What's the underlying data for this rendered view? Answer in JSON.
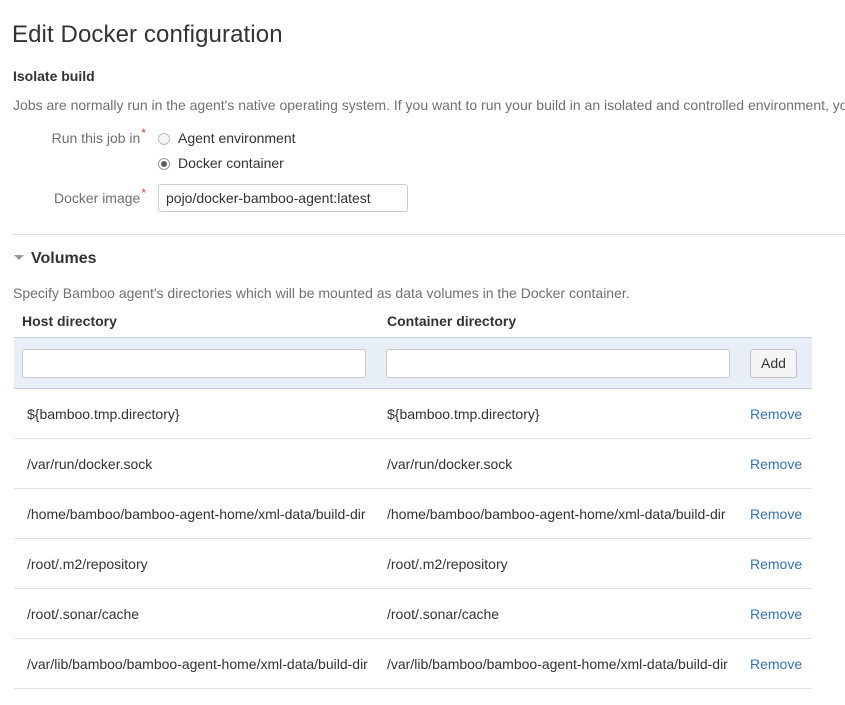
{
  "page": {
    "title": "Edit Docker configuration"
  },
  "isolate_build": {
    "heading": "Isolate build",
    "description": "Jobs are normally run in the agent's native operating system. If you want to run your build in an isolated and controlled environment, yo",
    "run_job_in": {
      "label": "Run this job in",
      "required_marker": "*",
      "options": [
        {
          "label": "Agent environment",
          "selected": false
        },
        {
          "label": "Docker container",
          "selected": true
        }
      ]
    },
    "docker_image": {
      "label": "Docker image",
      "required_marker": "*",
      "value": "pojo/docker-bamboo-agent:latest",
      "placeholder": ""
    }
  },
  "volumes": {
    "heading": "Volumes",
    "twisty_icon": "triangle-down-icon",
    "expanded": true,
    "description": "Specify Bamboo agent's directories which will be mounted as data volumes in the Docker container.",
    "columns": {
      "host": "Host directory",
      "container": "Container directory"
    },
    "add_row": {
      "host_value": "",
      "host_placeholder": "",
      "container_value": "",
      "container_placeholder": "",
      "add_label": "Add"
    },
    "remove_label": "Remove",
    "rows": [
      {
        "host": "${bamboo.tmp.directory}",
        "container": "${bamboo.tmp.directory}"
      },
      {
        "host": "/var/run/docker.sock",
        "container": "/var/run/docker.sock"
      },
      {
        "host": "/home/bamboo/bamboo-agent-home/xml-data/build-dir",
        "container": "/home/bamboo/bamboo-agent-home/xml-data/build-dir"
      },
      {
        "host": "/root/.m2/repository",
        "container": "/root/.m2/repository"
      },
      {
        "host": "/root/.sonar/cache",
        "container": "/root/.sonar/cache"
      },
      {
        "host": "/var/lib/bamboo/bamboo-agent-home/xml-data/build-dir",
        "container": "/var/lib/bamboo/bamboo-agent-home/xml-data/build-dir"
      }
    ]
  },
  "colors": {
    "link": "#3572b0",
    "required": "#d04437",
    "panel_bg": "#e8eef7",
    "muted_text": "#707070"
  }
}
